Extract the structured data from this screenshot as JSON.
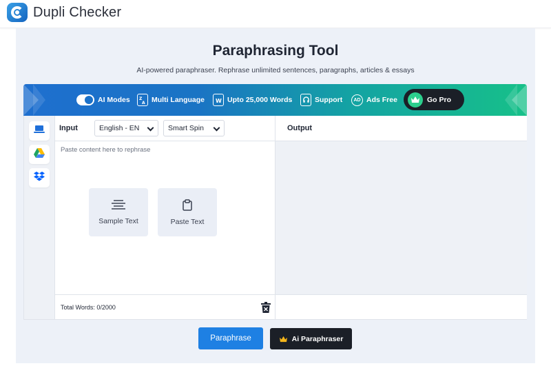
{
  "header": {
    "brand": "Dupli Checker"
  },
  "hero": {
    "title": "Paraphrasing Tool",
    "subtitle": "AI-powered paraphraser. Rephrase unlimited sentences, paragraphs, articles & essays"
  },
  "banner": {
    "features": [
      {
        "label": "AI Modes",
        "icon": "toggle-icon"
      },
      {
        "label": "Multi Language",
        "icon": "language-icon"
      },
      {
        "label": "Upto 25,000 Words",
        "icon": "document-icon"
      },
      {
        "label": "Support",
        "icon": "headset-icon"
      },
      {
        "label": "Ads Free",
        "icon": "ad-icon"
      }
    ],
    "go_pro": "Go Pro"
  },
  "sidebar": {
    "items": [
      "laptop-icon",
      "google-drive-icon",
      "dropbox-icon"
    ]
  },
  "input": {
    "label": "Input",
    "language": "English - EN",
    "mode": "Smart Spin",
    "placeholder": "Paste content here to rephrase",
    "sample_text": "Sample Text",
    "paste_text": "Paste Text",
    "word_count": "Total Words: 0/2000"
  },
  "output": {
    "label": "Output"
  },
  "actions": {
    "paraphrase": "Paraphrase",
    "ai_paraphraser": "Ai Paraphraser"
  },
  "colors": {
    "primary": "#1e80e3",
    "dark": "#1b1f27",
    "banner_start": "#1e6fcf",
    "banner_end": "#17c089",
    "panel_bg": "#edf1f8"
  }
}
